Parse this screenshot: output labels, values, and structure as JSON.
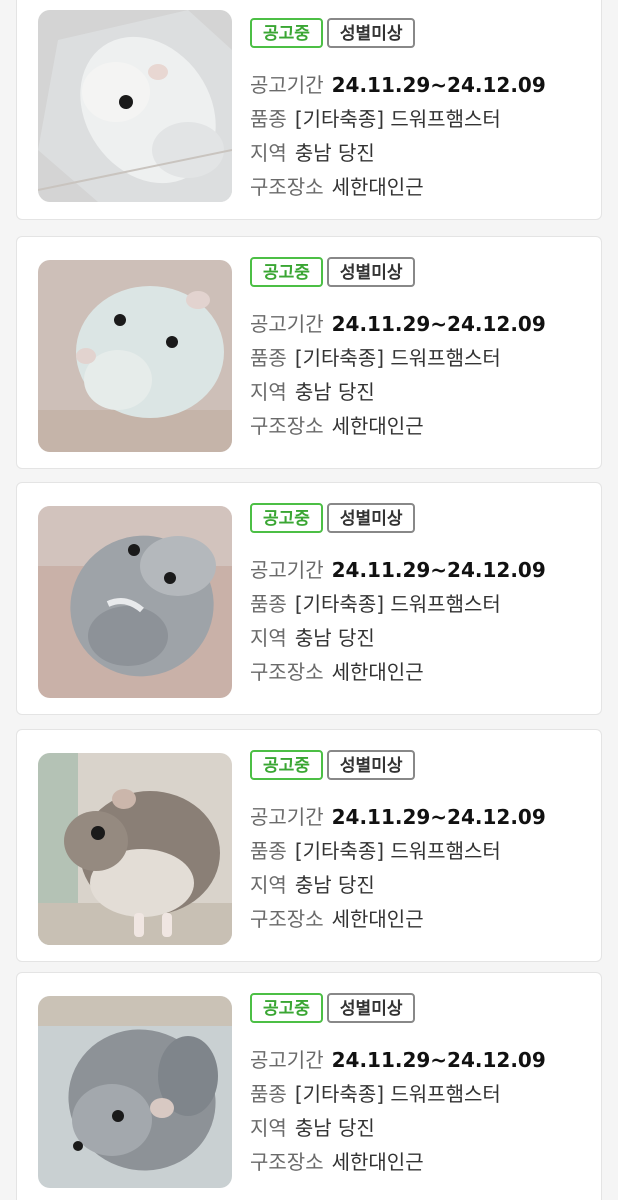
{
  "labels": {
    "period": "공고기간",
    "breed": "품종",
    "region": "지역",
    "rescue_place": "구조장소"
  },
  "listings": [
    {
      "status": "공고중",
      "sex": "성별미상",
      "period": "24.11.29~24.12.09",
      "breed": "[기타축종] 드워프햄스터",
      "region": "충남 당진",
      "rescue_place": "세한대인근"
    },
    {
      "status": "공고중",
      "sex": "성별미상",
      "period": "24.11.29~24.12.09",
      "breed": "[기타축종] 드워프햄스터",
      "region": "충남 당진",
      "rescue_place": "세한대인근"
    },
    {
      "status": "공고중",
      "sex": "성별미상",
      "period": "24.11.29~24.12.09",
      "breed": "[기타축종] 드워프햄스터",
      "region": "충남 당진",
      "rescue_place": "세한대인근"
    },
    {
      "status": "공고중",
      "sex": "성별미상",
      "period": "24.11.29~24.12.09",
      "breed": "[기타축종] 드워프햄스터",
      "region": "충남 당진",
      "rescue_place": "세한대인근"
    },
    {
      "status": "공고중",
      "sex": "성별미상",
      "period": "24.11.29~24.12.09",
      "breed": "[기타축종] 드워프햄스터",
      "region": "충남 당진",
      "rescue_place": "세한대인근"
    }
  ],
  "colors": {
    "status_green": "#3aa633",
    "badge_gray": "#888888",
    "card_border": "#e4e4e4"
  }
}
